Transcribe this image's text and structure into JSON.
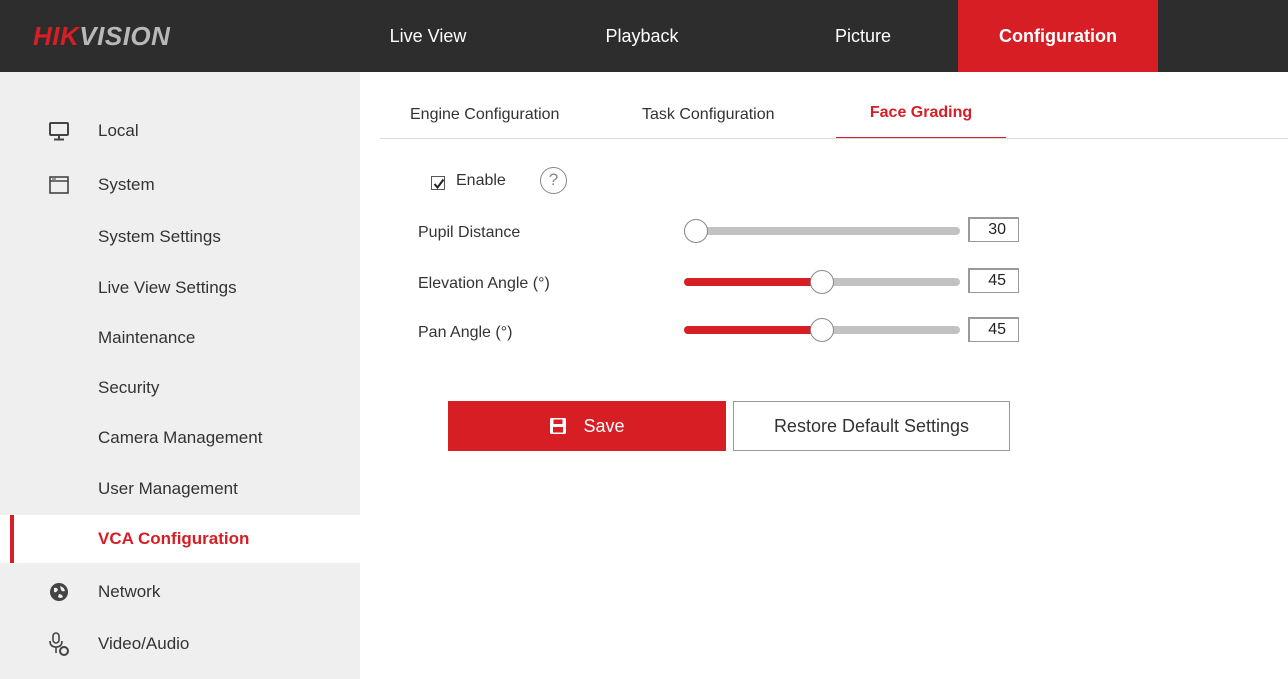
{
  "brand": {
    "logo_part1": "HIK",
    "logo_part2": "VISION"
  },
  "topnav": {
    "items": [
      "Live View",
      "Playback",
      "Picture",
      "Configuration"
    ],
    "active": "Configuration"
  },
  "sidebar": {
    "items": [
      {
        "label": "Local",
        "icon": "monitor-icon"
      },
      {
        "label": "System",
        "icon": "window-icon"
      },
      {
        "label": "System Settings"
      },
      {
        "label": "Live View Settings"
      },
      {
        "label": "Maintenance"
      },
      {
        "label": "Security"
      },
      {
        "label": "Camera Management"
      },
      {
        "label": "User Management"
      },
      {
        "label": "VCA Configuration"
      },
      {
        "label": "Network",
        "icon": "globe-icon"
      },
      {
        "label": "Video/Audio",
        "icon": "microphone-icon"
      }
    ],
    "active": "VCA Configuration"
  },
  "tabs": {
    "items": [
      "Engine Configuration",
      "Task Configuration",
      "Face Grading"
    ],
    "active": "Face Grading"
  },
  "form": {
    "enable": {
      "label": "Enable",
      "checked": true,
      "help_icon": "question-circle-icon"
    },
    "sliders": [
      {
        "label": "Pupil Distance",
        "value": "30",
        "min": 30,
        "max": 500
      },
      {
        "label": "Elevation Angle (°)",
        "value": "45",
        "min": 0,
        "max": 90
      },
      {
        "label": "Pan Angle (°)",
        "value": "45",
        "min": 0,
        "max": 90
      }
    ]
  },
  "buttons": {
    "save": "Save",
    "restore": "Restore Default Settings"
  },
  "colors": {
    "accent": "#d71e25",
    "topbar": "#2d2d2d",
    "sidebar": "#efefef"
  }
}
